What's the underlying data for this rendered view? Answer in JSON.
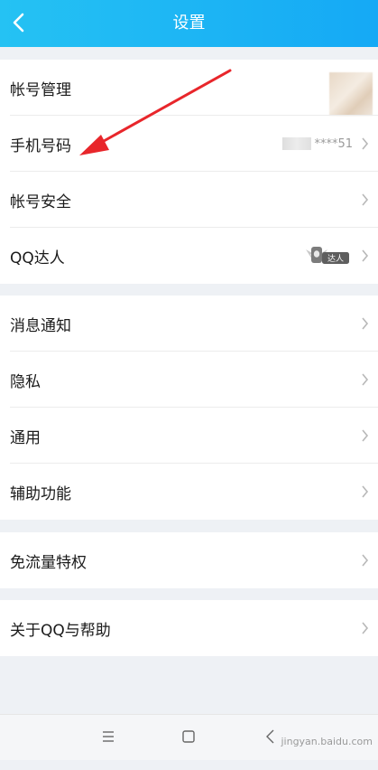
{
  "header": {
    "title": "设置"
  },
  "groups": [
    {
      "items": [
        {
          "label": "帐号管理"
        },
        {
          "label": "手机号码",
          "value_suffix": "****51"
        },
        {
          "label": "帐号安全"
        },
        {
          "label": "QQ达人",
          "badge_text": "达人"
        }
      ]
    },
    {
      "items": [
        {
          "label": "消息通知"
        },
        {
          "label": "隐私"
        },
        {
          "label": "通用"
        },
        {
          "label": "辅助功能"
        }
      ]
    },
    {
      "items": [
        {
          "label": "免流量特权"
        }
      ]
    },
    {
      "items": [
        {
          "label": "关于QQ与帮助"
        }
      ]
    }
  ],
  "watermark": {
    "text": "jingyan.baidu.com"
  },
  "colors": {
    "header": "#1fb5f4",
    "arrow": "#e8262b"
  }
}
